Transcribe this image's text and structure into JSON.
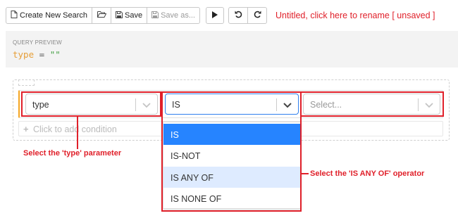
{
  "toolbar": {
    "create_new_search": "Create New Search",
    "open_icon": "folder-open-icon",
    "save": "Save",
    "save_as": "Save as...",
    "run_icon": "play-icon",
    "undo_icon": "undo-icon",
    "redo_icon": "redo-icon",
    "title": "Untitled, click here to rename [ unsaved ]"
  },
  "preview": {
    "label": "QUERY PREVIEW",
    "query_key": "type",
    "query_operator": "=",
    "query_value": "\"\""
  },
  "condition": {
    "parameter": "type",
    "operator": "IS",
    "value_placeholder": "Select...",
    "add_condition": "Click to add condition"
  },
  "operator_options": [
    "IS",
    "IS-NOT",
    "IS ANY OF",
    "IS NONE OF"
  ],
  "annotations": {
    "type_note": "Select the 'type' parameter",
    "operator_note": "Select the 'IS ANY OF' operator"
  },
  "colors": {
    "annotation_red": "#e0202a",
    "selected_option": "#2684ff",
    "focused_option": "#deebff",
    "row_accent": "#f5a623"
  }
}
